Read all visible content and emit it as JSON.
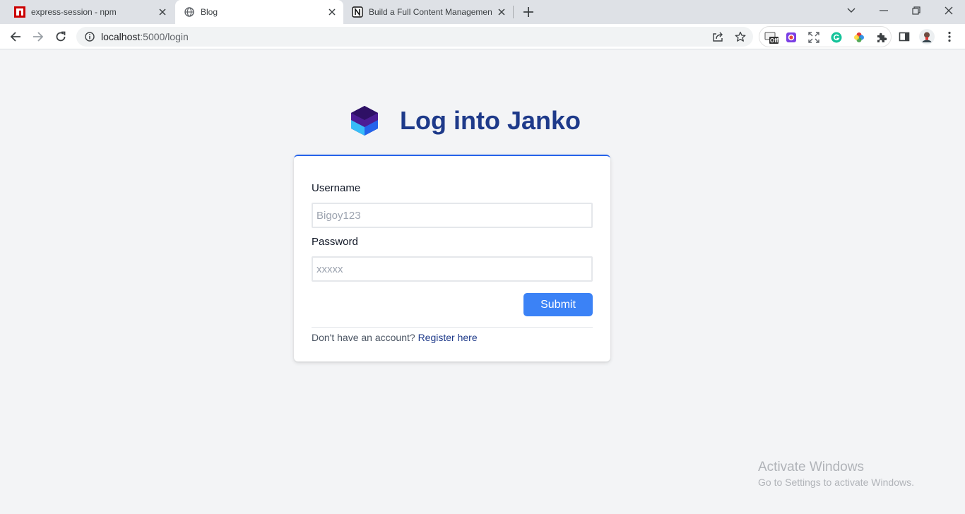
{
  "browser": {
    "tabs": [
      {
        "title": "express-session - npm",
        "favicon": "npm-icon",
        "active": false
      },
      {
        "title": "Blog",
        "favicon": "globe-icon",
        "active": true
      },
      {
        "title": "Build a Full Content Managemen",
        "favicon": "notion-icon",
        "active": false
      }
    ],
    "url_host": "localhost",
    "url_path": ":5000/login",
    "extension_badge": "Off",
    "icons": [
      "back-icon",
      "forward-icon",
      "reload-icon",
      "site-info-icon",
      "share-icon",
      "bookmark-star-icon",
      "extensions-puzzle-icon",
      "side-panel-icon",
      "profile-avatar",
      "menu-kebab-icon"
    ]
  },
  "page": {
    "heading": "Log into Janko",
    "form": {
      "username_label": "Username",
      "username_placeholder": "Bigoy123",
      "password_label": "Password",
      "password_placeholder": "xxxxx",
      "submit_label": "Submit"
    },
    "footer_text": "Don't have an account?",
    "register_link": "Register here"
  },
  "watermark": {
    "line1": "Activate Windows",
    "line2": "Go to Settings to activate Windows."
  },
  "colors": {
    "heading": "#1e3a8a",
    "accent": "#3b82f6",
    "card_border_top": "#2563eb",
    "page_bg": "#f3f4f6"
  }
}
